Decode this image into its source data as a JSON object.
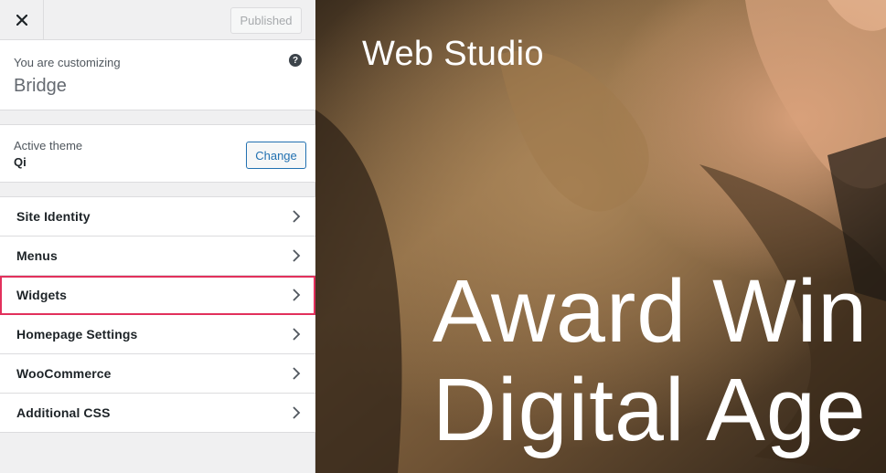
{
  "topbar": {
    "close_icon": "close-icon",
    "publish_label": "Published"
  },
  "info": {
    "pre_label": "You are customizing",
    "site_name": "Bridge",
    "help_icon": "?"
  },
  "theme": {
    "label": "Active theme",
    "name": "Qi",
    "change_label": "Change"
  },
  "sections": [
    {
      "label": "Site Identity",
      "icon": "chevron-right-icon"
    },
    {
      "label": "Menus",
      "icon": "chevron-right-icon"
    },
    {
      "label": "Widgets",
      "icon": "chevron-right-icon",
      "highlighted": true
    },
    {
      "label": "Homepage Settings",
      "icon": "chevron-right-icon"
    },
    {
      "label": "WooCommerce",
      "icon": "chevron-right-icon"
    },
    {
      "label": "Additional CSS",
      "icon": "chevron-right-icon"
    }
  ],
  "preview": {
    "site_title": "Web Studio",
    "hero_line_1": "Award Win",
    "hero_line_2": "Digital Age"
  },
  "colors": {
    "accent": "#2271b1",
    "highlight": "#e2305c"
  }
}
